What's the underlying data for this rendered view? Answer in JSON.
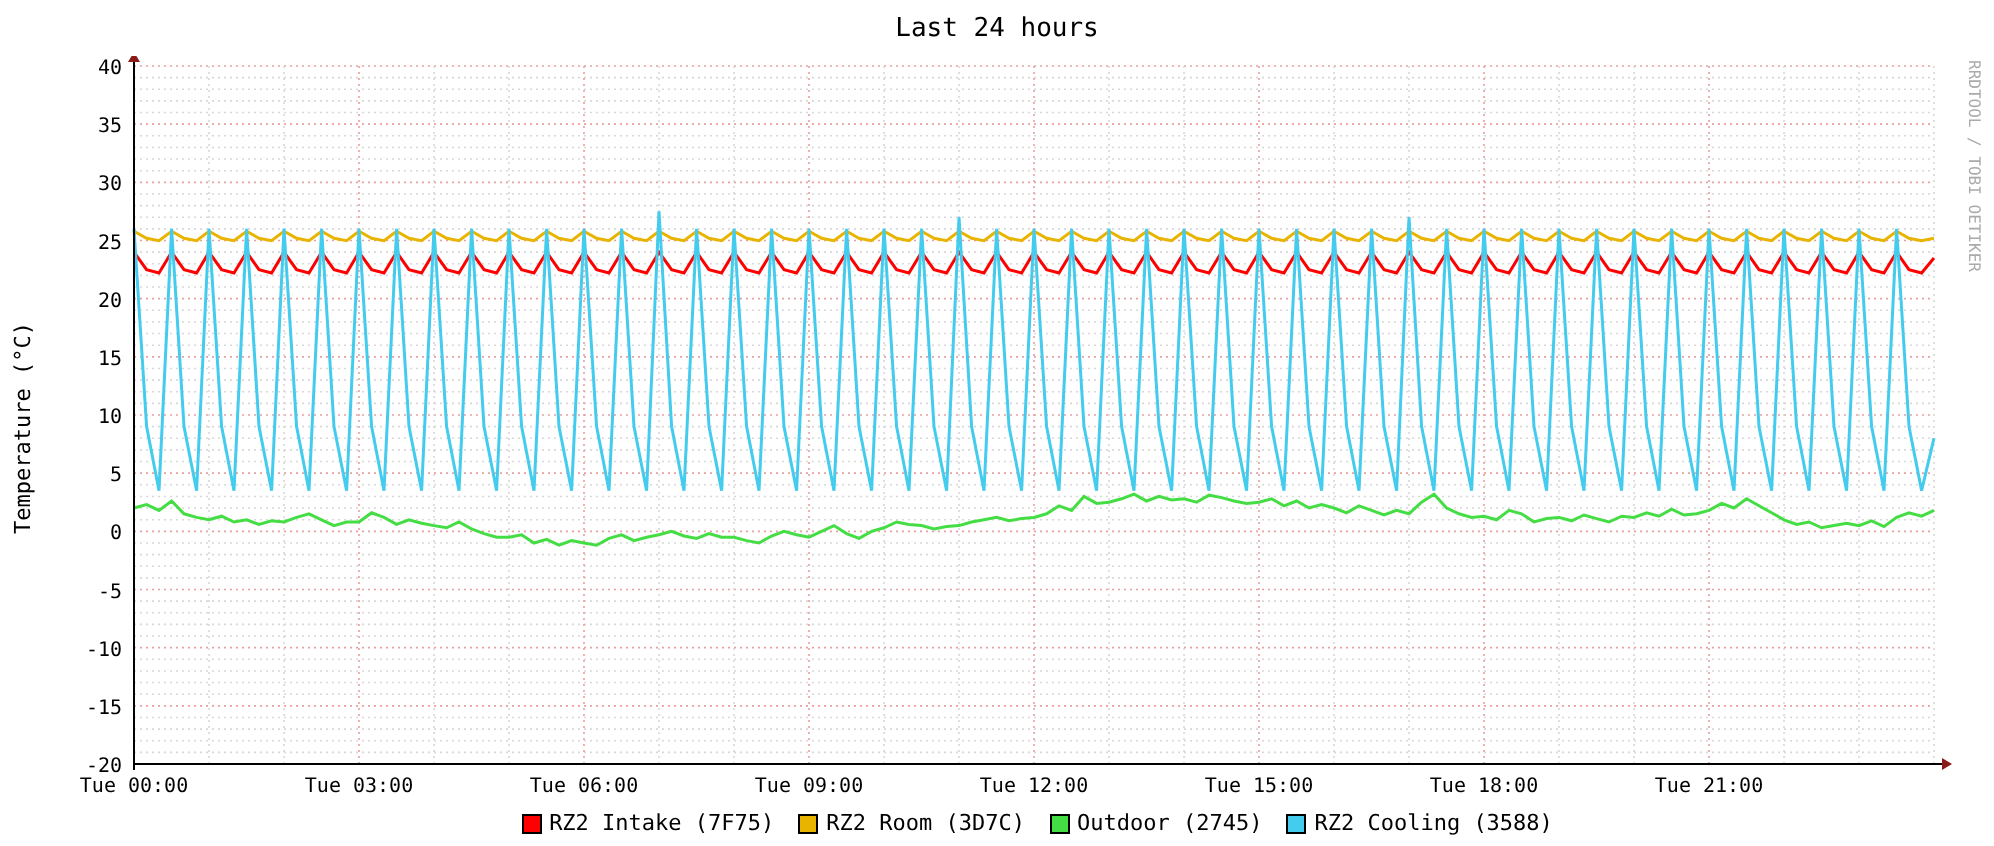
{
  "credit": "RRDTOOL / TOBI OETIKER",
  "chart_data": {
    "type": "line",
    "grid": true,
    "title": "Last 24 hours",
    "ylabel": "Temperature (°C)",
    "ylim": [
      -20,
      40
    ],
    "yticks": [
      -20,
      -15,
      -10,
      -5,
      0,
      5,
      10,
      15,
      20,
      25,
      30,
      35,
      40
    ],
    "categories": [
      "Tue 00:00",
      null,
      null,
      null,
      null,
      null,
      null,
      null,
      null,
      null,
      null,
      null,
      null,
      null,
      null,
      null,
      null,
      null,
      "Tue 03:00",
      null,
      null,
      null,
      null,
      null,
      null,
      null,
      null,
      null,
      null,
      null,
      null,
      null,
      null,
      null,
      null,
      null,
      "Tue 06:00",
      null,
      null,
      null,
      null,
      null,
      null,
      null,
      null,
      null,
      null,
      null,
      null,
      null,
      null,
      null,
      null,
      null,
      "Tue 09:00",
      null,
      null,
      null,
      null,
      null,
      null,
      null,
      null,
      null,
      null,
      null,
      null,
      null,
      null,
      null,
      null,
      null,
      "Tue 12:00",
      null,
      null,
      null,
      null,
      null,
      null,
      null,
      null,
      null,
      null,
      null,
      null,
      null,
      null,
      null,
      null,
      null,
      "Tue 15:00",
      null,
      null,
      null,
      null,
      null,
      null,
      null,
      null,
      null,
      null,
      null,
      null,
      null,
      null,
      null,
      null,
      null,
      "Tue 18:00",
      null,
      null,
      null,
      null,
      null,
      null,
      null,
      null,
      null,
      null,
      null,
      null,
      null,
      null,
      null,
      null,
      null,
      "Tue 21:00",
      null,
      null,
      null,
      null,
      null,
      null,
      null,
      null,
      null,
      null,
      null,
      null,
      null,
      null,
      null,
      null,
      null,
      null
    ],
    "series": [
      {
        "name": "RZ2 Intake (7F75)",
        "color": "#ff0000",
        "values": [
          24,
          22.5,
          22.2,
          24,
          22.5,
          22.2,
          24,
          22.5,
          22.2,
          24,
          22.5,
          22.2,
          24,
          22.5,
          22.2,
          24,
          22.5,
          22.2,
          24,
          22.5,
          22.2,
          24,
          22.5,
          22.2,
          24,
          22.5,
          22.2,
          24,
          22.5,
          22.2,
          24,
          22.5,
          22.2,
          24,
          22.5,
          22.2,
          24,
          22.5,
          22.2,
          24,
          22.5,
          22.2,
          24,
          22.5,
          22.2,
          24,
          22.5,
          22.2,
          24,
          22.5,
          22.2,
          24,
          22.5,
          22.2,
          24,
          22.5,
          22.2,
          24,
          22.5,
          22.2,
          24,
          22.5,
          22.2,
          24,
          22.5,
          22.2,
          24,
          22.5,
          22.2,
          24,
          22.5,
          22.2,
          24,
          22.5,
          22.2,
          24,
          22.5,
          22.2,
          24,
          22.5,
          22.2,
          24,
          22.5,
          22.2,
          24,
          22.5,
          22.2,
          24,
          22.5,
          22.2,
          24,
          22.5,
          22.2,
          24,
          22.5,
          22.2,
          24,
          22.5,
          22.2,
          24,
          22.5,
          22.2,
          24,
          22.5,
          22.2,
          24,
          22.5,
          22.2,
          24,
          22.5,
          22.2,
          24,
          22.5,
          22.2,
          24,
          22.5,
          22.2,
          24,
          22.5,
          22.2,
          24,
          22.5,
          22.2,
          24,
          22.5,
          22.2,
          24,
          22.5,
          22.2,
          24,
          22.5,
          22.2,
          24,
          22.5,
          22.2,
          24,
          22.5,
          22.2,
          24,
          22.5,
          22.2,
          24,
          22.5,
          22.2,
          23.5
        ]
      },
      {
        "name": "RZ2 Room (3D7C)",
        "color": "#e8b400",
        "values": [
          25.8,
          25.2,
          25,
          25.8,
          25.2,
          25,
          25.8,
          25.2,
          25,
          25.8,
          25.2,
          25,
          25.8,
          25.2,
          25,
          25.8,
          25.2,
          25,
          25.8,
          25.2,
          25,
          25.8,
          25.2,
          25,
          25.8,
          25.2,
          25,
          25.8,
          25.2,
          25,
          25.8,
          25.2,
          25,
          25.8,
          25.2,
          25,
          25.8,
          25.2,
          25,
          25.8,
          25.2,
          25,
          25.8,
          25.2,
          25,
          25.8,
          25.2,
          25,
          25.8,
          25.2,
          25,
          25.8,
          25.2,
          25,
          25.8,
          25.2,
          25,
          25.8,
          25.2,
          25,
          25.8,
          25.2,
          25,
          25.8,
          25.2,
          25,
          25.8,
          25.2,
          25,
          25.8,
          25.2,
          25,
          25.8,
          25.2,
          25,
          25.8,
          25.2,
          25,
          25.8,
          25.2,
          25,
          25.8,
          25.2,
          25,
          25.8,
          25.2,
          25,
          25.8,
          25.2,
          25,
          25.8,
          25.2,
          25,
          25.8,
          25.2,
          25,
          25.8,
          25.2,
          25,
          25.8,
          25.2,
          25,
          25.8,
          25.2,
          25,
          25.8,
          25.2,
          25,
          25.8,
          25.2,
          25,
          25.8,
          25.2,
          25,
          25.8,
          25.2,
          25,
          25.8,
          25.2,
          25,
          25.8,
          25.2,
          25,
          25.8,
          25.2,
          25,
          25.8,
          25.2,
          25,
          25.8,
          25.2,
          25,
          25.8,
          25.2,
          25,
          25.8,
          25.2,
          25,
          25.8,
          25.2,
          25,
          25.8,
          25.2,
          25,
          25.2
        ]
      },
      {
        "name": "Outdoor (2745)",
        "color": "#44dd44",
        "values": [
          2,
          2.3,
          1.8,
          2.6,
          1.5,
          1.2,
          1,
          1.3,
          0.8,
          1,
          0.6,
          0.9,
          0.8,
          1.2,
          1.5,
          1,
          0.5,
          0.8,
          0.8,
          1.6,
          1.2,
          0.6,
          1,
          0.7,
          0.5,
          0.3,
          0.8,
          0.2,
          -0.2,
          -0.5,
          -0.5,
          -0.3,
          -1,
          -0.7,
          -1.2,
          -0.8,
          -1,
          -1.2,
          -0.6,
          -0.3,
          -0.8,
          -0.5,
          -0.3,
          0,
          -0.4,
          -0.6,
          -0.2,
          -0.5,
          -0.5,
          -0.8,
          -1,
          -0.4,
          0,
          -0.3,
          -0.5,
          0,
          0.5,
          -0.2,
          -0.6,
          0,
          0.3,
          0.8,
          0.6,
          0.5,
          0.2,
          0.4,
          0.5,
          0.8,
          1,
          1.2,
          0.9,
          1.1,
          1.2,
          1.5,
          2.2,
          1.8,
          3,
          2.4,
          2.5,
          2.8,
          3.2,
          2.6,
          3,
          2.7,
          2.8,
          2.5,
          3.1,
          2.9,
          2.6,
          2.4,
          2.5,
          2.8,
          2.2,
          2.6,
          2,
          2.3,
          2,
          1.6,
          2.2,
          1.8,
          1.4,
          1.8,
          1.5,
          2.5,
          3.2,
          2,
          1.5,
          1.2,
          1.3,
          1,
          1.8,
          1.5,
          0.8,
          1.1,
          1.2,
          0.9,
          1.4,
          1.1,
          0.8,
          1.3,
          1.2,
          1.6,
          1.3,
          1.9,
          1.4,
          1.5,
          1.8,
          2.4,
          2,
          2.8,
          2.2,
          1.6,
          1,
          0.6,
          0.8,
          0.3,
          0.5,
          0.7,
          0.5,
          0.9,
          0.4,
          1.2,
          1.6,
          1.3,
          1.8
        ]
      },
      {
        "name": "RZ2 Cooling (3588)",
        "color": "#44ccee",
        "values": [
          26,
          9,
          3.5,
          26,
          9,
          3.5,
          26,
          9,
          3.5,
          26,
          9,
          3.5,
          26,
          9,
          3.5,
          26,
          9,
          3.5,
          26,
          9,
          3.5,
          26,
          9,
          3.5,
          26,
          9,
          3.5,
          26,
          9,
          3.5,
          26,
          9,
          3.5,
          26,
          9,
          3.5,
          26,
          9,
          3.5,
          26,
          9,
          3.5,
          27.5,
          9,
          3.5,
          26,
          9,
          3.5,
          26,
          9,
          3.5,
          26,
          9,
          3.5,
          26,
          9,
          3.5,
          26,
          9,
          3.5,
          26,
          9,
          3.5,
          26,
          9,
          3.5,
          27,
          9,
          3.5,
          26,
          9,
          3.5,
          26,
          9,
          3.5,
          26,
          9,
          3.5,
          26,
          9,
          3.5,
          26,
          9,
          3.5,
          26,
          9,
          3.5,
          26,
          9,
          3.5,
          26,
          9,
          3.5,
          26,
          9,
          3.5,
          26,
          9,
          3.5,
          26,
          9,
          3.5,
          27,
          9,
          3.5,
          26,
          9,
          3.5,
          26,
          9,
          3.5,
          26,
          9,
          3.5,
          26,
          9,
          3.5,
          26,
          9,
          3.5,
          26,
          9,
          3.5,
          26,
          9,
          3.5,
          26,
          9,
          3.5,
          26,
          9,
          3.5,
          26,
          9,
          3.5,
          26,
          9,
          3.5,
          26,
          9,
          3.5,
          26,
          9,
          3.5,
          8
        ]
      }
    ]
  }
}
